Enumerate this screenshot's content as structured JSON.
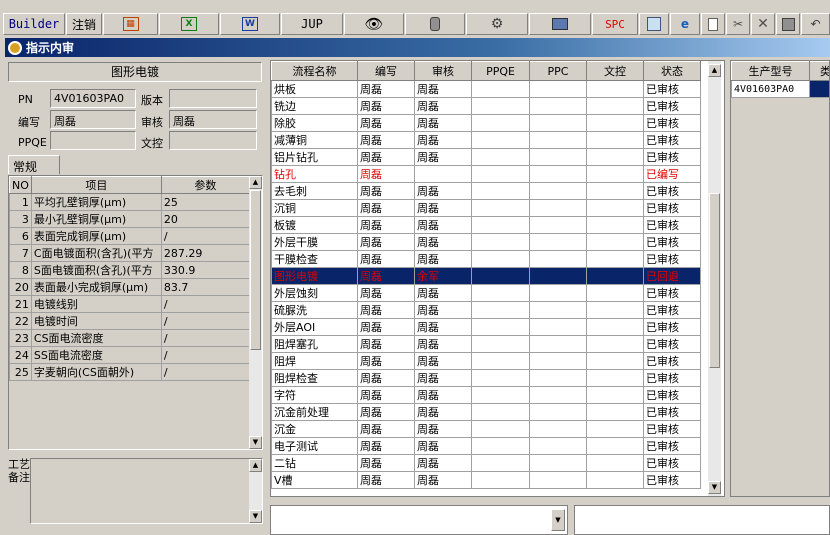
{
  "toolbar": {
    "builder": "Builder",
    "logout": "注销",
    "excel_icon": "X",
    "word_icon": "W",
    "jup": "JUP",
    "spc": "SPC"
  },
  "window": {
    "title": "指示内审"
  },
  "left": {
    "section_title": "图形电镀",
    "pn_label": "PN",
    "pn_value": "4V01603PA0",
    "version_label": "版本",
    "version_value": "",
    "author_label": "编写",
    "author_value": "周磊",
    "review_label": "审核",
    "review_value": "周磊",
    "ppqe_label": "PPQE",
    "ppqe_value": "",
    "doc_label": "文控",
    "doc_value": "",
    "tab": "常规",
    "params_headers": [
      "NO",
      "项目",
      "参数"
    ],
    "params": [
      {
        "no": "1",
        "item": "平均孔壁铜厚(μm)",
        "value": "25"
      },
      {
        "no": "3",
        "item": "最小孔壁铜厚(μm)",
        "value": "20"
      },
      {
        "no": "6",
        "item": "表面完成铜厚(μm)",
        "value": "/"
      },
      {
        "no": "7",
        "item": "C面电镀面积(含孔)(平方",
        "value": "287.29"
      },
      {
        "no": "8",
        "item": "S面电镀面积(含孔)(平方",
        "value": "330.9"
      },
      {
        "no": "20",
        "item": "表面最小完成铜厚(μm)",
        "value": "83.7"
      },
      {
        "no": "21",
        "item": "电镀线别",
        "value": "/"
      },
      {
        "no": "22",
        "item": "电镀时间",
        "value": "/"
      },
      {
        "no": "23",
        "item": "CS面电流密度",
        "value": "/"
      },
      {
        "no": "24",
        "item": "SS面电流密度",
        "value": "/"
      },
      {
        "no": "25",
        "item": "字麦朝向(CS面朝外)",
        "value": "/"
      }
    ],
    "note_label": "工艺备注"
  },
  "flow": {
    "headers": [
      "流程名称",
      "编写",
      "审核",
      "PPQE",
      "PPC",
      "文控",
      "状态"
    ],
    "rows": [
      {
        "name": "烘板",
        "author": "周磊",
        "review": "周磊",
        "status": "已审核",
        "style": ""
      },
      {
        "name": "铣边",
        "author": "周磊",
        "review": "周磊",
        "status": "已审核",
        "style": ""
      },
      {
        "name": "除胶",
        "author": "周磊",
        "review": "周磊",
        "status": "已审核",
        "style": ""
      },
      {
        "name": "减薄铜",
        "author": "周磊",
        "review": "周磊",
        "status": "已审核",
        "style": ""
      },
      {
        "name": "铝片钻孔",
        "author": "周磊",
        "review": "周磊",
        "status": "已审核",
        "style": ""
      },
      {
        "name": "钻孔",
        "author": "周磊",
        "review": "",
        "status": "已编写",
        "style": "red"
      },
      {
        "name": "去毛刺",
        "author": "周磊",
        "review": "周磊",
        "status": "已审核",
        "style": ""
      },
      {
        "name": "沉铜",
        "author": "周磊",
        "review": "周磊",
        "status": "已审核",
        "style": ""
      },
      {
        "name": "板镀",
        "author": "周磊",
        "review": "周磊",
        "status": "已审核",
        "style": ""
      },
      {
        "name": "外层干膜",
        "author": "周磊",
        "review": "周磊",
        "status": "已审核",
        "style": ""
      },
      {
        "name": "干膜检查",
        "author": "周磊",
        "review": "周磊",
        "status": "已审核",
        "style": ""
      },
      {
        "name": "图形电镀",
        "author": "周磊",
        "review": "余军",
        "status": "已回退",
        "style": "sel"
      },
      {
        "name": "外层蚀刻",
        "author": "周磊",
        "review": "周磊",
        "status": "已审核",
        "style": ""
      },
      {
        "name": "硫脲洗",
        "author": "周磊",
        "review": "周磊",
        "status": "已审核",
        "style": ""
      },
      {
        "name": "外层AOI",
        "author": "周磊",
        "review": "周磊",
        "status": "已审核",
        "style": ""
      },
      {
        "name": "阻焊塞孔",
        "author": "周磊",
        "review": "周磊",
        "status": "已审核",
        "style": ""
      },
      {
        "name": "阻焊",
        "author": "周磊",
        "review": "周磊",
        "status": "已审核",
        "style": ""
      },
      {
        "name": "阻焊检查",
        "author": "周磊",
        "review": "周磊",
        "status": "已审核",
        "style": ""
      },
      {
        "name": "字符",
        "author": "周磊",
        "review": "周磊",
        "status": "已审核",
        "style": ""
      },
      {
        "name": "沉金前处理",
        "author": "周磊",
        "review": "周磊",
        "status": "已审核",
        "style": ""
      },
      {
        "name": "沉金",
        "author": "周磊",
        "review": "周磊",
        "status": "已审核",
        "style": ""
      },
      {
        "name": "电子测试",
        "author": "周磊",
        "review": "周磊",
        "status": "已审核",
        "style": ""
      },
      {
        "name": "二钻",
        "author": "周磊",
        "review": "周磊",
        "status": "已审核",
        "style": ""
      },
      {
        "name": "V槽",
        "author": "周磊",
        "review": "周磊",
        "status": "已审核",
        "style": ""
      }
    ]
  },
  "models": {
    "headers": [
      "生产型号",
      "类"
    ],
    "items": [
      "4V01603PA0"
    ]
  }
}
